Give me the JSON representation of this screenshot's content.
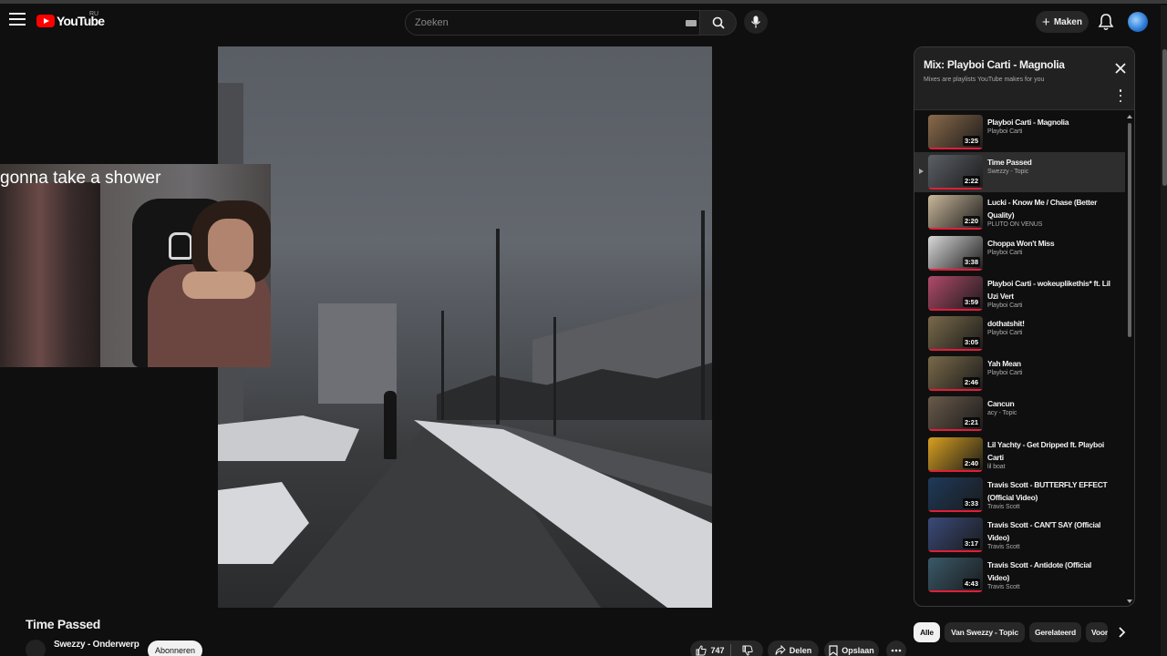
{
  "header": {
    "logo_text": "YouTube",
    "logo_country": "RU",
    "search_placeholder": "Zoeken",
    "create_label": "Maken"
  },
  "webcam": {
    "caption": "gonna take a shower"
  },
  "video": {
    "title": "Time Passed",
    "channel": "Swezzy - Onderwerp",
    "subscribe_label": "Abonneren",
    "likes": "747",
    "share_label": "Deel­en",
    "save_label": "Opslaan"
  },
  "playlist": {
    "title": "Mix: Playboi Carti - Magnolia",
    "subtitle": "Mixes are playlists YouTube makes for you",
    "items": [
      {
        "title": "Playboi Carti - Magnolia",
        "channel": "Playboi Carti",
        "duration": "3:25",
        "thumb_color": "#8a6a4a"
      },
      {
        "title": "Time Passed",
        "channel": "Swezzy - Topic",
        "duration": "2:22",
        "thumb_color": "#5c6066"
      },
      {
        "title": "Lucki - Know Me / Chase (Better Quality)",
        "channel": "PLUTO ON VENUS",
        "duration": "2:20",
        "thumb_color": "#c9b79a"
      },
      {
        "title": "Choppa Won't Miss",
        "channel": "Playboi Carti",
        "duration": "3:38",
        "thumb_color": "#d9d9d9"
      },
      {
        "title": "Playboi Carti - wokeuplikethis* ft. Lil Uzi Vert",
        "channel": "Playboi Carti",
        "duration": "3:59",
        "thumb_color": "#b04a6a"
      },
      {
        "title": "dothatshit!",
        "channel": "Playboi Carti",
        "duration": "3:05",
        "thumb_color": "#7a6a4a"
      },
      {
        "title": "Yah Mean",
        "channel": "Playboi Carti",
        "duration": "2:46",
        "thumb_color": "#7a6a4a"
      },
      {
        "title": "Cancun",
        "channel": "acy - Topic",
        "duration": "2:21",
        "thumb_color": "#6a5a4a"
      },
      {
        "title": "Lil Yachty - Get Dripped ft. Playboi Carti",
        "channel": "lil boat",
        "duration": "2:40",
        "thumb_color": "#d8a020"
      },
      {
        "title": "Travis Scott - BUTTERFLY EFFECT (Official Video)",
        "channel": "Travis Scott",
        "duration": "3:33",
        "thumb_color": "#1e3a5a"
      },
      {
        "title": "Travis Scott - CAN'T SAY (Official Video)",
        "channel": "Travis Scott",
        "duration": "3:17",
        "thumb_color": "#3a4a7a"
      },
      {
        "title": "Travis Scott - Antidote (Official Video)",
        "channel": "Travis Scott",
        "duration": "4:43",
        "thumb_color": "#3a5a6a"
      }
    ]
  },
  "chips": [
    "Alle",
    "Van Swezzy - Topic",
    "Gerelateerd",
    "Voor jou"
  ],
  "colors": {
    "background": "#0f0f0f",
    "accent": "#ff0000",
    "progress": "#e21d3a"
  }
}
